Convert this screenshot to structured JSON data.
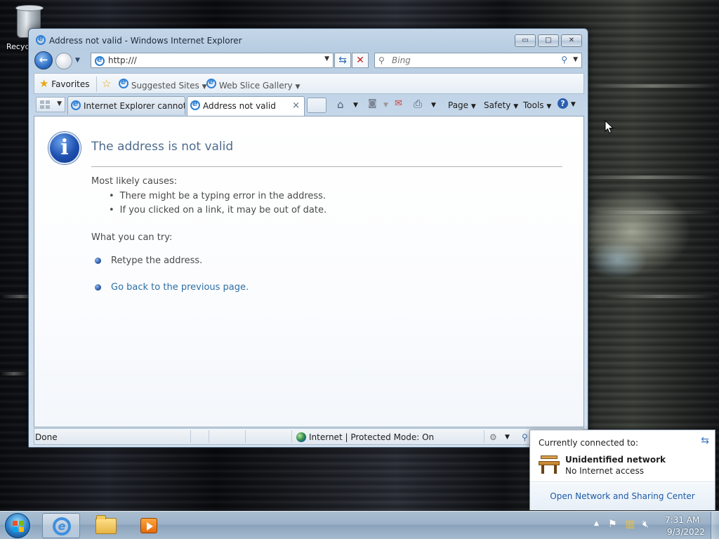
{
  "desktop": {
    "recycle_bin_label": "Recycle"
  },
  "window": {
    "title": "Address not valid - Windows Internet Explorer",
    "minimize_glyph": "▭",
    "maximize_glyph": "□",
    "close_glyph": "✕"
  },
  "address_bar": {
    "url": "http:///",
    "refresh_glyph": "⇆",
    "stop_glyph": "✕"
  },
  "search": {
    "placeholder": "Bing"
  },
  "favorites_bar": {
    "favorites_label": "Favorites",
    "suggested_sites_label": "Suggested Sites",
    "web_slice_gallery_label": "Web Slice Gallery"
  },
  "tabs": [
    {
      "label": "Internet Explorer cannot ..."
    },
    {
      "label": "Address not valid",
      "close_glyph": "×"
    }
  ],
  "command_bar": {
    "page_label": "Page",
    "safety_label": "Safety",
    "tools_label": "Tools"
  },
  "error_page": {
    "title": "The address is not valid",
    "causes_heading": "Most likely causes:",
    "causes": [
      "There might be a typing error in the address.",
      "If you clicked on a link, it may be out of date."
    ],
    "try_heading": "What you can try:",
    "retype": "Retype the address.",
    "go_back": "Go back to the previous page."
  },
  "status_bar": {
    "status_text": "Done",
    "zone_text": "Internet | Protected Mode: On"
  },
  "network_popup": {
    "heading": "Currently connected to:",
    "network_name": "Unidentified network",
    "network_status": "No Internet access",
    "link": "Open Network and Sharing Center"
  },
  "taskbar": {
    "time": "7:31 AM",
    "date": "9/3/2022"
  },
  "colors": {
    "link_blue": "#2c6fa4",
    "title_blue": "#4d6b8c",
    "stop_red": "#c81e1e"
  },
  "icons": {
    "back": "arrow-left-icon",
    "forward": "arrow-right-icon",
    "refresh": "refresh-icon",
    "stop": "close-icon",
    "search": "magnifier-icon",
    "favorites": "star-icon",
    "home": "home-icon",
    "feeds": "rss-icon",
    "mail": "mail-icon",
    "print": "printer-icon",
    "help": "help-icon",
    "info": "info-icon",
    "network": "bench-icon"
  }
}
